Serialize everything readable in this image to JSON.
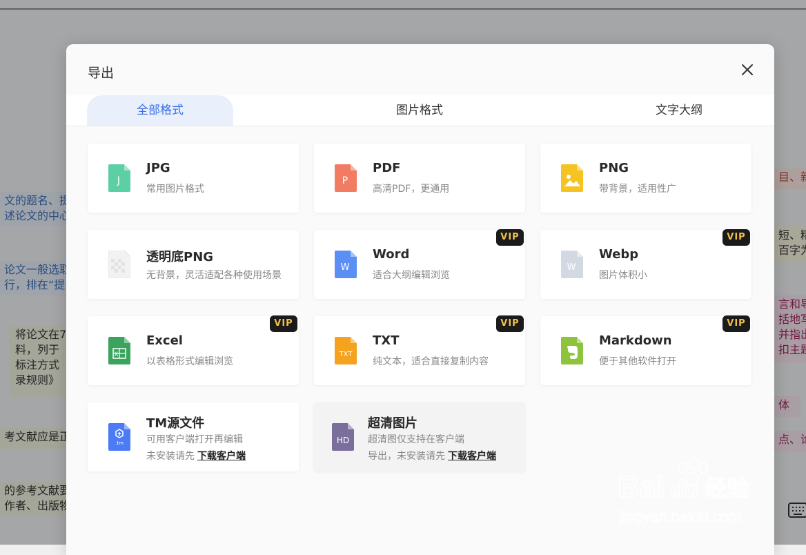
{
  "dialog": {
    "title": "导出",
    "tabs": [
      {
        "label": "全部格式",
        "active": true
      },
      {
        "label": "图片格式",
        "active": false
      },
      {
        "label": "文字大纲",
        "active": false
      }
    ],
    "vip_label": "VIP",
    "cards": [
      {
        "name": "JPG",
        "desc": "常用图片格式",
        "icon": "jpg-file-icon",
        "icon_letter": "J",
        "color": "#5ccfa4",
        "vip": false
      },
      {
        "name": "PDF",
        "desc": "高清PDF，更通用",
        "icon": "pdf-file-icon",
        "icon_letter": "P",
        "color": "#f17b63",
        "vip": false
      },
      {
        "name": "PNG",
        "desc": "带背景，适用性广",
        "icon": "png-image-icon",
        "icon_letter": "",
        "color": "#f5c322",
        "vip": false
      },
      {
        "name": "透明底PNG",
        "desc": "无背景，灵活适配各种使用场景",
        "icon": "transparent-png-icon",
        "icon_letter": "",
        "color": "#e6e6e6",
        "vip": false
      },
      {
        "name": "Word",
        "desc": "适合大纲编辑浏览",
        "icon": "word-file-icon",
        "icon_letter": "W",
        "color": "#5b8ff5",
        "vip": true
      },
      {
        "name": "Webp",
        "desc": "图片体积小",
        "icon": "webp-file-icon",
        "icon_letter": "W",
        "color": "#d3d9e3",
        "vip": true
      },
      {
        "name": "Excel",
        "desc": "以表格形式编辑浏览",
        "icon": "excel-file-icon",
        "icon_letter": "X",
        "color": "#3aa35e",
        "vip": true
      },
      {
        "name": "TXT",
        "desc": "纯文本，适合直接复制内容",
        "icon": "txt-file-icon",
        "icon_letter": "TXT",
        "color": "#f5a21f",
        "vip": true
      },
      {
        "name": "Markdown",
        "desc": "便于其他软件打开",
        "icon": "evernote-markdown-icon",
        "icon_letter": "",
        "color": "#8ec43d",
        "vip": true
      }
    ],
    "tm_card": {
      "name": "TM源文件",
      "desc": "可用客户端打开再编辑",
      "desc2": "未安装请先",
      "link": "下载客户端",
      "icon_letter": ".tm",
      "color": "#4b7cf5"
    },
    "hd_card": {
      "name": "超清图片",
      "desc": "超清图仅支持在客户端",
      "desc2": "导出，未安装请先",
      "link": "下载客户端",
      "icon_letter": "HD",
      "color": "#7a6f9c"
    }
  },
  "background_notes": [
    {
      "lines": [
        "文的题名、提",
        "述论文的中心"
      ],
      "color": "#3d6fb8",
      "bg": "#e4ebf5"
    },
    {
      "lines": [
        "论文一般选取",
        "行，排在“提"
      ],
      "color": "#3d6fb8",
      "bg": "#e4ebf5"
    },
    {
      "lines": [
        "将论文在7",
        "料，列于",
        "标注方式",
        "录规则》"
      ],
      "color": "#333333",
      "bg": "#eceedd"
    },
    {
      "lines": [
        "考文献应是正"
      ],
      "color": "#333333",
      "bg": "#eceedd"
    },
    {
      "lines": [
        "的参考文献要",
        "作者、出版物"
      ],
      "color": "#333333",
      "bg": "#eceedd"
    },
    {
      "lines": [
        "目、新"
      ],
      "color": "#b04a3a",
      "bg": "#f6e4e0"
    },
    {
      "lines": [
        "短、精",
        "百字为"
      ],
      "color": "#333333",
      "bg": "#f2efda"
    },
    {
      "lines": [
        "言和导",
        "括地写",
        "并指出",
        "扣主题"
      ],
      "color": "#a02860",
      "bg": "#f3e3ea"
    },
    {
      "lines": [
        "体"
      ],
      "color": "#a02860",
      "bg": "#f3e3ea"
    },
    {
      "lines": [
        "点、论"
      ],
      "color": "#a02860",
      "bg": "#f3e3ea"
    }
  ],
  "watermark": {
    "brand": "Bai",
    "brand2": "du",
    "cn": "经验",
    "url": "jingyan.baidu.com"
  }
}
